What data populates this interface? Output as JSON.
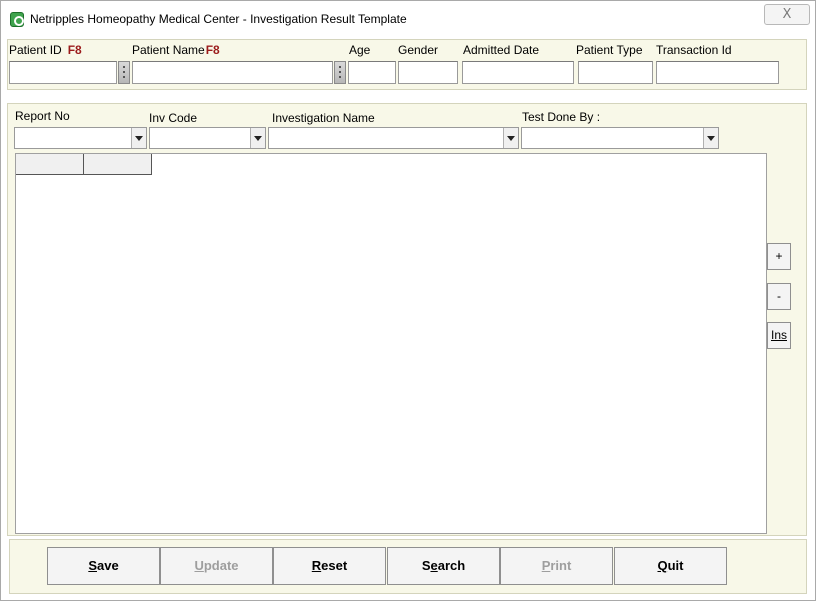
{
  "window": {
    "title": "Netripples Homeopathy Medical Center  - Investigation Result Template",
    "close_glyph": "X"
  },
  "patient": {
    "patient_id_label": "Patient ID",
    "patient_id_hotkey": "F8",
    "patient_name_label": "Patient Name",
    "patient_name_hotkey": "F8",
    "age_label": "Age",
    "gender_label": "Gender",
    "admitted_date_label": "Admitted Date",
    "patient_type_label": "Patient Type",
    "transaction_id_label": "Transaction Id",
    "patient_id_value": "",
    "patient_name_value": "",
    "age_value": "",
    "gender_value": "",
    "admitted_date_value": "",
    "patient_type_value": "",
    "transaction_id_value": ""
  },
  "investigation": {
    "report_no_label": "Report No",
    "inv_code_label": "Inv Code",
    "investigation_name_label": "Investigation Name",
    "test_done_by_label": "Test Done By :",
    "report_no_value": "",
    "inv_code_value": "",
    "investigation_name_value": "",
    "test_done_by_value": ""
  },
  "grid_side": {
    "add_label": "+",
    "remove_label": "-",
    "insert_label": "Ins"
  },
  "footer": {
    "save": {
      "access": "S",
      "rest": "ave",
      "enabled": true
    },
    "update": {
      "access": "U",
      "rest": "pdate",
      "enabled": false
    },
    "reset": {
      "access": "R",
      "rest": "eset",
      "enabled": true
    },
    "search": {
      "pre": "S",
      "access": "e",
      "rest": "arch",
      "enabled": true
    },
    "print": {
      "access": "P",
      "rest": "rint",
      "enabled": false
    },
    "quit": {
      "access": "Q",
      "rest": "uit",
      "enabled": true
    }
  },
  "colors": {
    "panel_bg": "#f8f8e8",
    "hotkey": "#9b1b1b",
    "disabled_text": "#9e9e9e",
    "app_icon": "#3fa34d"
  }
}
